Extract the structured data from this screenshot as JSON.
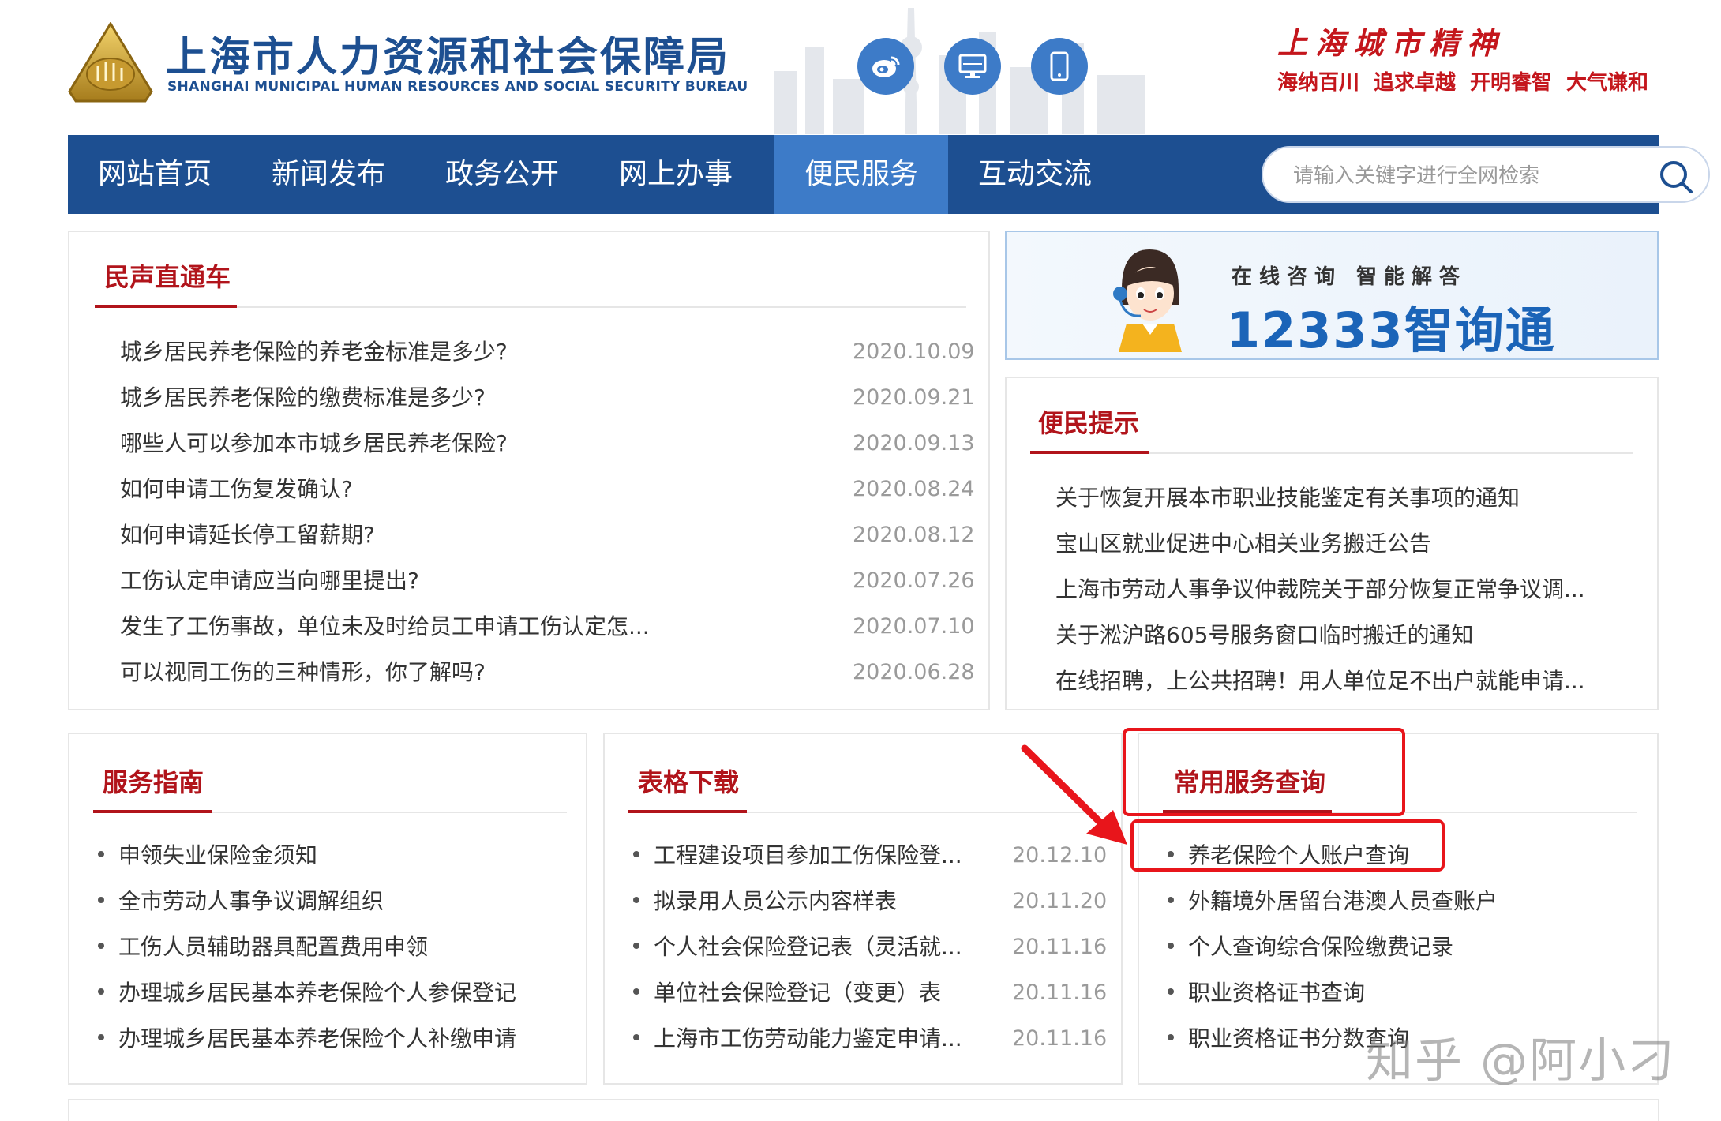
{
  "header": {
    "title_cn": "上海市人力资源和社会保障局",
    "title_en": "SHANGHAI MUNICIPAL HUMAN RESOURCES AND SOCIAL SECURITY BUREAU",
    "emblem_text": "",
    "icons": [
      "weibo-icon",
      "desktop-icon",
      "mobile-icon"
    ],
    "spirit_title": "上海城市精神",
    "spirit_words": [
      "海纳百川",
      "追求卓越",
      "开明睿智",
      "大气谦和"
    ]
  },
  "nav": {
    "items": [
      "网站首页",
      "新闻发布",
      "政务公开",
      "网上办事",
      "便民服务",
      "互动交流"
    ],
    "active": "便民服务",
    "search_placeholder": "请输入关键字进行全网检索"
  },
  "minsheng": {
    "title": "民声直通车",
    "items": [
      {
        "text": "城乡居民养老保险的养老金标准是多少?",
        "date": "2020.10.09"
      },
      {
        "text": "城乡居民养老保险的缴费标准是多少?",
        "date": "2020.09.21"
      },
      {
        "text": "哪些人可以参加本市城乡居民养老保险?",
        "date": "2020.09.13"
      },
      {
        "text": "如何申请工伤复发确认?",
        "date": "2020.08.24"
      },
      {
        "text": "如何申请延长停工留薪期?",
        "date": "2020.08.12"
      },
      {
        "text": "工伤认定申请应当向哪里提出?",
        "date": "2020.07.26"
      },
      {
        "text": "发生了工伤事故，单位未及时给员工申请工伤认定怎...",
        "date": "2020.07.10"
      },
      {
        "text": "可以视同工伤的三种情形，你了解吗?",
        "date": "2020.06.28"
      }
    ]
  },
  "banner": {
    "subtitle": "在线咨询 智能解答",
    "title": "12333智询通"
  },
  "bianmin": {
    "title": "便民提示",
    "items": [
      "关于恢复开展本市职业技能鉴定有关事项的通知",
      "宝山区就业促进中心相关业务搬迁公告",
      "上海市劳动人事争议仲裁院关于部分恢复正常争议调...",
      "关于淞沪路605号服务窗口临时搬迁的通知",
      "在线招聘，上公共招聘！用人单位足不出户就能申请..."
    ]
  },
  "fuwu": {
    "title": "服务指南",
    "items": [
      "申领失业保险金须知",
      "全市劳动人事争议调解组织",
      "工伤人员辅助器具配置费用申领",
      "办理城乡居民基本养老保险个人参保登记",
      "办理城乡居民基本养老保险个人补缴申请"
    ]
  },
  "biaoge": {
    "title": "表格下载",
    "items": [
      {
        "text": "工程建设项目参加工伤保险登...",
        "date": "20.12.10"
      },
      {
        "text": "拟录用人员公示内容样表",
        "date": "20.11.20"
      },
      {
        "text": "个人社会保险登记表（灵活就...",
        "date": "20.11.16"
      },
      {
        "text": "单位社会保险登记（变更）表",
        "date": "20.11.16"
      },
      {
        "text": "上海市工伤劳动能力鉴定申请...",
        "date": "20.11.16"
      }
    ]
  },
  "changyong": {
    "title": "常用服务查询",
    "items": [
      "养老保险个人账户查询",
      "外籍境外居留台港澳人员查账户",
      "个人查询综合保险缴费记录",
      "职业资格证书查询",
      "职业资格证书分数查询"
    ]
  },
  "watermark": "知乎 @阿小刁",
  "colors": {
    "nav_bg": "#1d4f91",
    "nav_active": "#3d7bc8",
    "heading_red": "#b1141b",
    "annotation_red": "#e8151b"
  }
}
